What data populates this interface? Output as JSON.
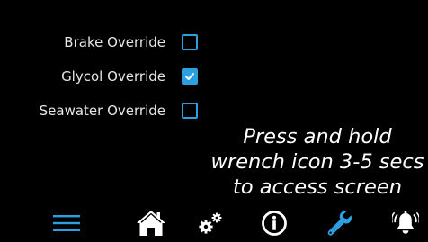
{
  "overrides": [
    {
      "label": "Brake Override",
      "checked": false
    },
    {
      "label": "Glycol Override",
      "checked": true
    },
    {
      "label": "Seawater Override",
      "checked": false
    }
  ],
  "instruction": {
    "line1": "Press and hold",
    "line2": "wrench icon 3-5 secs",
    "line3": "to access screen"
  },
  "nav": {
    "items": [
      {
        "icon": "menu-icon",
        "active": true
      },
      {
        "icon": "home-icon",
        "active": false
      },
      {
        "icon": "gears-icon",
        "active": false
      },
      {
        "icon": "info-icon",
        "active": false
      },
      {
        "icon": "wrench-icon",
        "active": true
      },
      {
        "icon": "alarm-bell-icon",
        "active": false
      }
    ]
  },
  "colors": {
    "background": "#000000",
    "accent": "#2b9fe0",
    "text": "#ffffff"
  }
}
